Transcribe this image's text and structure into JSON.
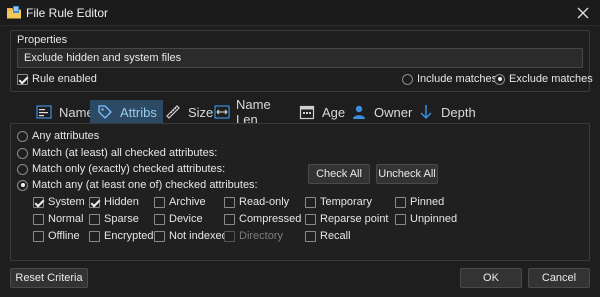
{
  "window": {
    "title": "File Rule Editor",
    "icons": {
      "app": "folder-rule-icon",
      "close": "close-icon"
    }
  },
  "properties": {
    "group_label": "Properties",
    "name_value": "Exclude hidden and system files",
    "rule_enabled_label": "Rule enabled",
    "rule_enabled": true,
    "include_matches_label": "Include matches",
    "exclude_matches_label": "Exclude matches",
    "match_mode": "exclude"
  },
  "tabs": [
    {
      "label": "Name",
      "icon": "name-icon",
      "active": false
    },
    {
      "label": "Attribs",
      "icon": "tag-icon",
      "active": true
    },
    {
      "label": "Size",
      "icon": "ruler-icon",
      "active": false
    },
    {
      "label": "Name Len",
      "icon": "width-icon",
      "active": false
    },
    {
      "label": "Age",
      "icon": "calendar-icon",
      "active": false
    },
    {
      "label": "Owner",
      "icon": "user-icon",
      "active": false
    },
    {
      "label": "Depth",
      "icon": "arrow-down-icon",
      "active": false
    }
  ],
  "attribs": {
    "options": [
      {
        "label": "Any attributes",
        "checked": false
      },
      {
        "label": "Match (at least) all checked attributes:",
        "checked": false
      },
      {
        "label": "Match only (exactly) checked attributes:",
        "checked": false
      },
      {
        "label": "Match any (at least one of) checked attributes:",
        "checked": true
      }
    ],
    "check_all_label": "Check All",
    "uncheck_all_label": "Uncheck All",
    "columns": [
      [
        {
          "label": "System",
          "checked": true
        },
        {
          "label": "Normal",
          "checked": false
        },
        {
          "label": "Offline",
          "checked": false
        }
      ],
      [
        {
          "label": "Hidden",
          "checked": true
        },
        {
          "label": "Sparse",
          "checked": false
        },
        {
          "label": "Encrypted",
          "checked": false
        }
      ],
      [
        {
          "label": "Archive",
          "checked": false
        },
        {
          "label": "Device",
          "checked": false
        },
        {
          "label": "Not indexed",
          "checked": false
        }
      ],
      [
        {
          "label": "Read-only",
          "checked": false
        },
        {
          "label": "Compressed",
          "checked": false
        },
        {
          "label": "Directory",
          "checked": false,
          "disabled": true
        }
      ],
      [
        {
          "label": "Temporary",
          "checked": false
        },
        {
          "label": "Reparse point",
          "checked": false
        },
        {
          "label": "Recall",
          "checked": false
        }
      ],
      [
        {
          "label": "Pinned",
          "checked": false
        },
        {
          "label": "Unpinned",
          "checked": false
        }
      ]
    ]
  },
  "footer": {
    "reset_label": "Reset Criteria",
    "ok_label": "OK",
    "cancel_label": "Cancel"
  },
  "colors": {
    "background": "#1e1e1e",
    "active_tab_bg": "#2c4a63",
    "active_tab_text": "#9ccbf0",
    "icon_blue": "#3b8ee0"
  }
}
